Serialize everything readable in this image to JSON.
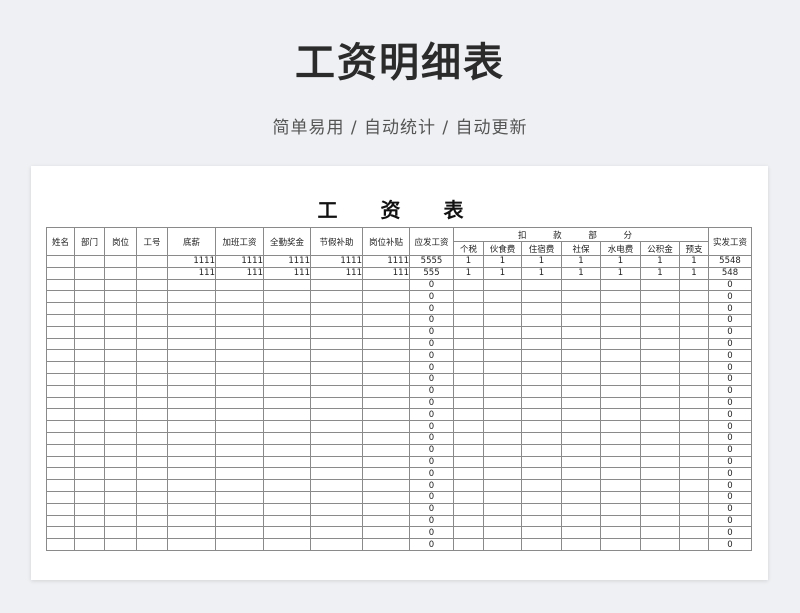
{
  "hero": {
    "title": "工资明细表",
    "subtitle": "简单易用  /  自动统计  /  自动更新"
  },
  "sheet": {
    "title": "工 资 表",
    "headers": {
      "name": "姓名",
      "dept": "部门",
      "position": "岗位",
      "emp_id": "工号",
      "base": "底薪",
      "overtime": "加班工资",
      "attendance_bonus": "全勤奖金",
      "holiday_allowance": "节假补助",
      "position_allowance": "岗位补贴",
      "gross": "应发工资",
      "deductions_group": "扣 款 部 分",
      "tax": "个税",
      "meals": "伙食费",
      "lodging": "住宿费",
      "social": "社保",
      "utilities": "水电费",
      "fund": "公积金",
      "advance": "预支",
      "net": "实发工资"
    },
    "rows": [
      {
        "name": "",
        "dept": "",
        "position": "",
        "emp_id": "",
        "base": "1111",
        "overtime": "1111",
        "attendance_bonus": "1111",
        "holiday_allowance": "1111",
        "position_allowance": "1111",
        "gross": "5555",
        "tax": "1",
        "meals": "1",
        "lodging": "1",
        "social": "1",
        "utilities": "1",
        "fund": "1",
        "advance": "1",
        "net": "5548"
      },
      {
        "name": "",
        "dept": "",
        "position": "",
        "emp_id": "",
        "base": "111",
        "overtime": "111",
        "attendance_bonus": "111",
        "holiday_allowance": "111",
        "position_allowance": "111",
        "gross": "555",
        "tax": "1",
        "meals": "1",
        "lodging": "1",
        "social": "1",
        "utilities": "1",
        "fund": "1",
        "advance": "1",
        "net": "548"
      },
      {
        "gross": "0",
        "net": "0"
      },
      {
        "gross": "0",
        "net": "0"
      },
      {
        "gross": "0",
        "net": "0"
      },
      {
        "gross": "0",
        "net": "0"
      },
      {
        "gross": "0",
        "net": "0"
      },
      {
        "gross": "0",
        "net": "0"
      },
      {
        "gross": "0",
        "net": "0"
      },
      {
        "gross": "0",
        "net": "0"
      },
      {
        "gross": "0",
        "net": "0"
      },
      {
        "gross": "0",
        "net": "0"
      },
      {
        "gross": "0",
        "net": "0"
      },
      {
        "gross": "0",
        "net": "0"
      },
      {
        "gross": "0",
        "net": "0"
      },
      {
        "gross": "0",
        "net": "0"
      },
      {
        "gross": "0",
        "net": "0"
      },
      {
        "gross": "0",
        "net": "0"
      },
      {
        "gross": "0",
        "net": "0"
      },
      {
        "gross": "0",
        "net": "0"
      },
      {
        "gross": "0",
        "net": "0"
      },
      {
        "gross": "0",
        "net": "0"
      },
      {
        "gross": "0",
        "net": "0"
      },
      {
        "gross": "0",
        "net": "0"
      },
      {
        "gross": "0",
        "net": "0"
      }
    ]
  }
}
